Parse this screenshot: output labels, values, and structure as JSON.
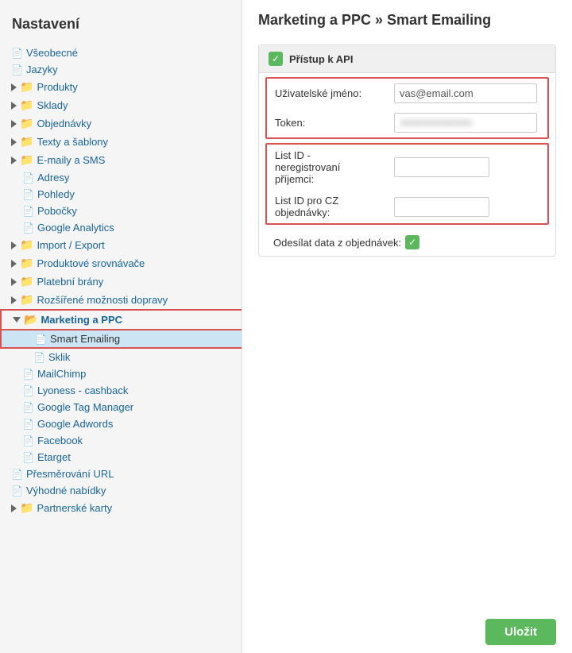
{
  "sidebar": {
    "title": "Nastavení",
    "items": [
      {
        "id": "vseobecne",
        "label": "Všeobecné",
        "type": "file",
        "indent": 1
      },
      {
        "id": "jazyky",
        "label": "Jazyky",
        "type": "file",
        "indent": 1
      },
      {
        "id": "produkty",
        "label": "Produkty",
        "type": "folder-closed",
        "indent": 1
      },
      {
        "id": "sklady",
        "label": "Sklady",
        "type": "folder-closed",
        "indent": 1
      },
      {
        "id": "objednavky",
        "label": "Objednávky",
        "type": "folder-closed",
        "indent": 1
      },
      {
        "id": "texty",
        "label": "Texty a šablony",
        "type": "folder-closed",
        "indent": 1
      },
      {
        "id": "emaily",
        "label": "E-maily a SMS",
        "type": "folder-closed",
        "indent": 1
      },
      {
        "id": "adresy",
        "label": "Adresy",
        "type": "file",
        "indent": 2
      },
      {
        "id": "pohledy",
        "label": "Pohledy",
        "type": "file",
        "indent": 2
      },
      {
        "id": "pobocky",
        "label": "Pobočky",
        "type": "file",
        "indent": 2
      },
      {
        "id": "google-analytics",
        "label": "Google Analytics",
        "type": "file",
        "indent": 2
      },
      {
        "id": "import-export",
        "label": "Import / Export",
        "type": "folder-closed",
        "indent": 1
      },
      {
        "id": "produktove",
        "label": "Produktové srovnávače",
        "type": "folder-closed",
        "indent": 1
      },
      {
        "id": "platebni",
        "label": "Platební brány",
        "type": "folder-closed",
        "indent": 1
      },
      {
        "id": "rozsirene",
        "label": "Rozšířené možnosti dopravy",
        "type": "folder-closed",
        "indent": 1
      },
      {
        "id": "marketing",
        "label": "Marketing a PPC",
        "type": "folder-open",
        "indent": 1
      },
      {
        "id": "smart-emailing",
        "label": "Smart Emailing",
        "type": "file",
        "indent": 3,
        "active": true
      },
      {
        "id": "sklik",
        "label": "Sklik",
        "type": "file",
        "indent": 3
      },
      {
        "id": "mailchimp",
        "label": "MailChimp",
        "type": "file",
        "indent": 2
      },
      {
        "id": "lyoness",
        "label": "Lyoness - cashback",
        "type": "file",
        "indent": 2
      },
      {
        "id": "google-tag",
        "label": "Google Tag Manager",
        "type": "file",
        "indent": 2
      },
      {
        "id": "google-adwords",
        "label": "Google Adwords",
        "type": "file",
        "indent": 2
      },
      {
        "id": "facebook",
        "label": "Facebook",
        "type": "file",
        "indent": 2
      },
      {
        "id": "etarget",
        "label": "Etarget",
        "type": "file",
        "indent": 2
      },
      {
        "id": "presmerovani",
        "label": "Přesměrování URL",
        "type": "file",
        "indent": 1
      },
      {
        "id": "vyhodne",
        "label": "Výhodné nabídky",
        "type": "file",
        "indent": 1
      },
      {
        "id": "partnerske",
        "label": "Partnerské karty",
        "type": "folder-closed",
        "indent": 1
      }
    ]
  },
  "main": {
    "page_title": "Marketing a PPC » Smart Emailing",
    "api_section": {
      "header": "Přístup k API",
      "fields": {
        "username_label": "Uživatelské jméno:",
        "username_value": "vas@email.com",
        "token_label": "Token:",
        "token_value": "••••••••••••••••••••",
        "list_id_label": "List ID - neregistrovaní příjemci:",
        "list_id_value": "",
        "list_id_cz_label": "List ID pro CZ objednávky:",
        "list_id_cz_value": "",
        "send_data_label": "Odesílat data z objednávek:"
      }
    },
    "save_button": "Uložit"
  }
}
